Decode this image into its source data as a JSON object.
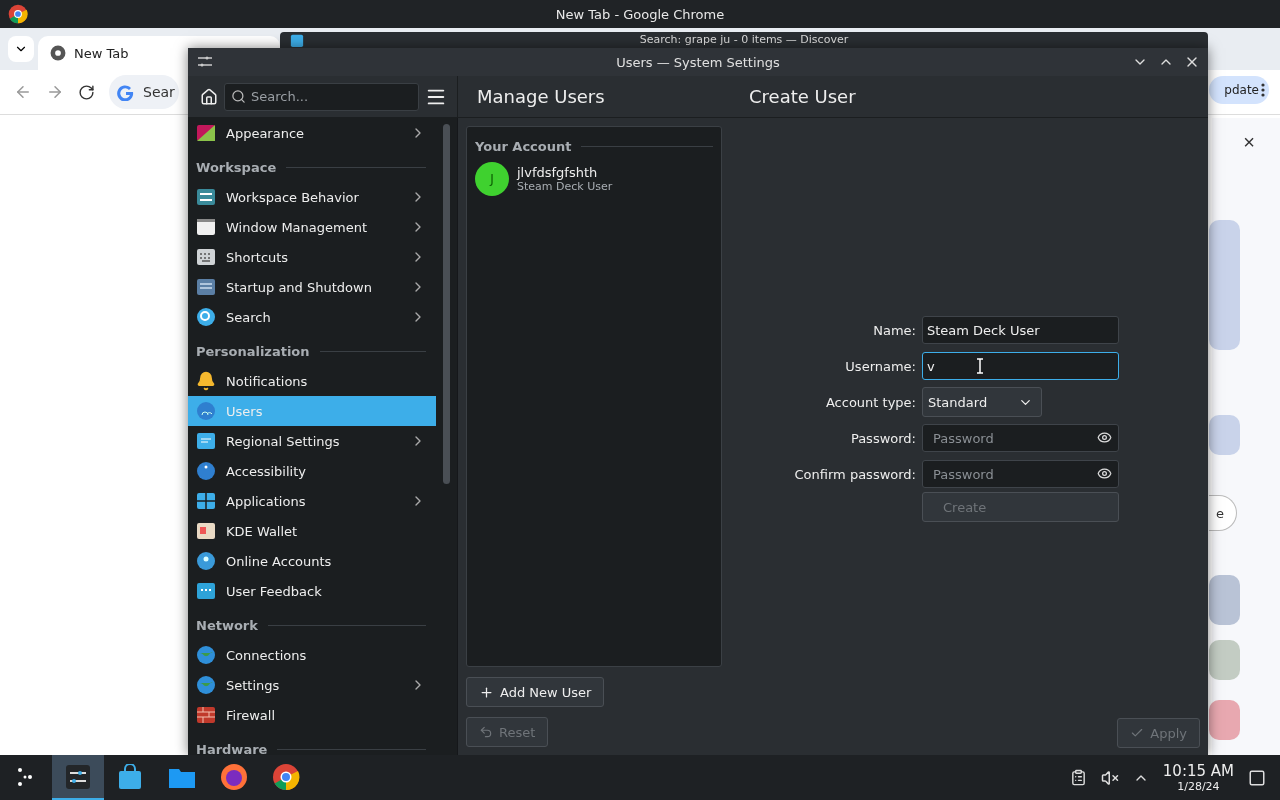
{
  "chrome": {
    "title": "New Tab - Google Chrome",
    "tab": {
      "label": "New Tab"
    },
    "omnibox": {
      "placeholder": "Sear"
    },
    "update_button": "pdate",
    "side_panel": {
      "close": "×",
      "button_label": "e"
    }
  },
  "discover": {
    "title": "Search: grape ju - 0 items — Discover"
  },
  "settings": {
    "title": "Users — System Settings",
    "search": {
      "placeholder": "Search..."
    },
    "sidebar": [
      {
        "kind": "item",
        "label": "Appearance",
        "has_children": true,
        "selected": false
      },
      {
        "kind": "header",
        "label": "Workspace"
      },
      {
        "kind": "item",
        "label": "Workspace Behavior",
        "has_children": true,
        "selected": false
      },
      {
        "kind": "item",
        "label": "Window Management",
        "has_children": true,
        "selected": false
      },
      {
        "kind": "item",
        "label": "Shortcuts",
        "has_children": true,
        "selected": false
      },
      {
        "kind": "item",
        "label": "Startup and Shutdown",
        "has_children": true,
        "selected": false
      },
      {
        "kind": "item",
        "label": "Search",
        "has_children": true,
        "selected": false
      },
      {
        "kind": "header",
        "label": "Personalization"
      },
      {
        "kind": "item",
        "label": "Notifications",
        "has_children": false,
        "selected": false
      },
      {
        "kind": "item",
        "label": "Users",
        "has_children": false,
        "selected": true
      },
      {
        "kind": "item",
        "label": "Regional Settings",
        "has_children": true,
        "selected": false
      },
      {
        "kind": "item",
        "label": "Accessibility",
        "has_children": false,
        "selected": false
      },
      {
        "kind": "item",
        "label": "Applications",
        "has_children": true,
        "selected": false
      },
      {
        "kind": "item",
        "label": "KDE Wallet",
        "has_children": false,
        "selected": false
      },
      {
        "kind": "item",
        "label": "Online Accounts",
        "has_children": false,
        "selected": false
      },
      {
        "kind": "item",
        "label": "User Feedback",
        "has_children": false,
        "selected": false
      },
      {
        "kind": "header",
        "label": "Network"
      },
      {
        "kind": "item",
        "label": "Connections",
        "has_children": false,
        "selected": false
      },
      {
        "kind": "item",
        "label": "Settings",
        "has_children": true,
        "selected": false
      },
      {
        "kind": "item",
        "label": "Firewall",
        "has_children": false,
        "selected": false
      },
      {
        "kind": "header",
        "label": "Hardware"
      }
    ],
    "page_titles": [
      "Manage Users",
      "Create User"
    ],
    "account_section": "Your Account",
    "accounts": [
      {
        "initial": "J",
        "name": "jlvfdsfgfshth",
        "type": "Steam Deck User",
        "color": "#3fd12f"
      }
    ],
    "add_user": "Add New User",
    "reset": {
      "label": "Reset",
      "disabled": true
    },
    "apply": {
      "label": "Apply",
      "disabled": true
    },
    "form": [
      {
        "kind": "text",
        "label": "Name:",
        "value": "Steam Deck User",
        "focused": false
      },
      {
        "kind": "text",
        "label": "Username:",
        "value": "v",
        "focused": true
      },
      {
        "kind": "select",
        "label": "Account type:",
        "value": "Standard"
      },
      {
        "kind": "password",
        "label": "Password:",
        "placeholder": "Password"
      },
      {
        "kind": "password",
        "label": "Confirm password:",
        "placeholder": "Password"
      }
    ],
    "create": {
      "label": "Create",
      "disabled": true
    }
  },
  "taskbar": {
    "apps": [
      {
        "selected": false
      },
      {
        "selected": true
      },
      {
        "selected": false
      },
      {
        "selected": false
      },
      {
        "selected": false
      },
      {
        "selected": false
      }
    ],
    "clock": "10:15 AM",
    "date": "1/28/24"
  }
}
